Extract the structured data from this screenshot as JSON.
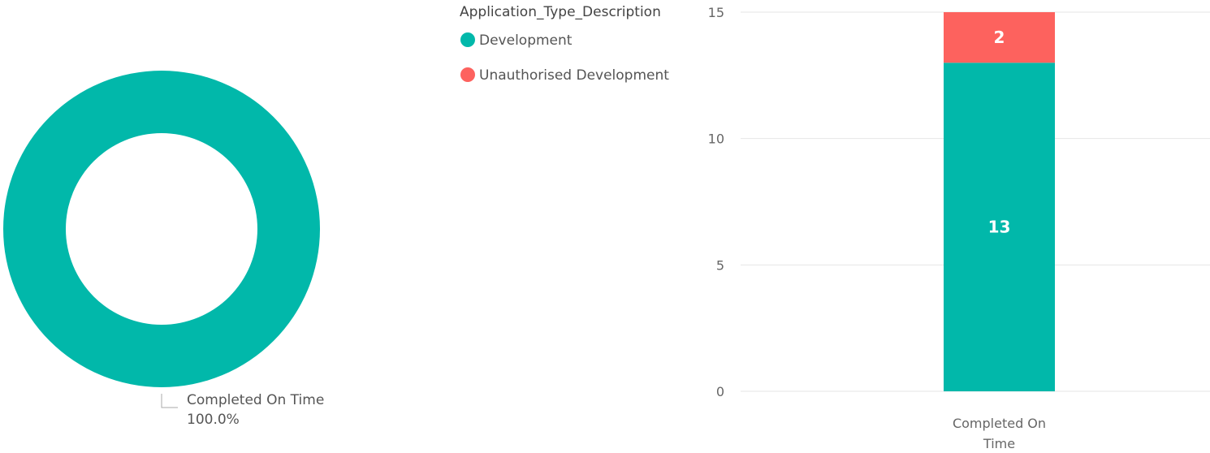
{
  "colors": {
    "development": "#01B8AA",
    "unauthorised": "#FD625E",
    "gridline": "#e6e6e6",
    "leader": "#aaaaaa"
  },
  "chart_data": [
    {
      "type": "pie",
      "variant": "donut",
      "slices": [
        {
          "label": "Completed On Time",
          "value": 100.0,
          "display": "100.0%",
          "color": "#01B8AA"
        }
      ],
      "label_line1": "Completed On Time",
      "label_line2": "100.0%"
    },
    {
      "type": "bar",
      "stacked": true,
      "legend_title": "Application_Type_Description",
      "legend_placement": "top-left",
      "categories": [
        "Completed On Time"
      ],
      "category_label_lines": [
        "Completed On",
        "Time"
      ],
      "series": [
        {
          "name": "Development",
          "values": [
            13
          ],
          "labels": [
            "13"
          ],
          "color": "#01B8AA"
        },
        {
          "name": "Unauthorised Development",
          "values": [
            2
          ],
          "labels": [
            "2"
          ],
          "color": "#FD625E"
        }
      ],
      "ylim": [
        0,
        15
      ],
      "yticks": [
        0,
        5,
        10,
        15
      ],
      "ytick_labels": [
        "0",
        "5",
        "10",
        "15"
      ],
      "grid": true
    }
  ]
}
